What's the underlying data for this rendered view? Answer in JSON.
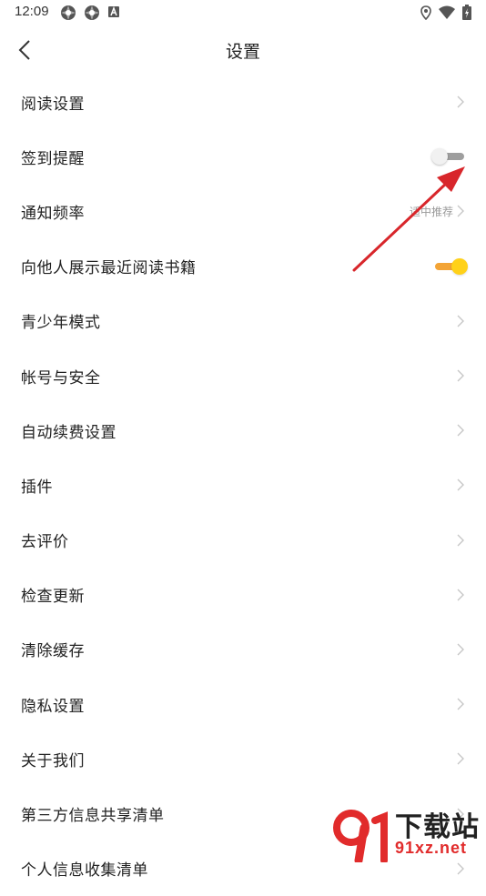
{
  "status_bar": {
    "time": "12:09"
  },
  "header": {
    "title": "设置"
  },
  "settings": [
    {
      "label": "阅读设置",
      "type": "link"
    },
    {
      "label": "签到提醒",
      "type": "toggle",
      "enabled": false
    },
    {
      "label": "通知频率",
      "type": "link",
      "value": "适中推荐"
    },
    {
      "label": "向他人展示最近阅读书籍",
      "type": "toggle",
      "enabled": true
    },
    {
      "label": "青少年模式",
      "type": "link"
    },
    {
      "label": "帐号与安全",
      "type": "link"
    },
    {
      "label": "自动续费设置",
      "type": "link"
    },
    {
      "label": "插件",
      "type": "link"
    },
    {
      "label": "去评价",
      "type": "link"
    },
    {
      "label": "检查更新",
      "type": "link"
    },
    {
      "label": "清除缓存",
      "type": "link"
    },
    {
      "label": "隐私设置",
      "type": "link"
    },
    {
      "label": "关于我们",
      "type": "link"
    },
    {
      "label": "第三方信息共享清单",
      "type": "link"
    },
    {
      "label": "个人信息收集清单",
      "type": "link"
    }
  ],
  "colors": {
    "toggle_on_track": "#f3a436",
    "toggle_on_knob": "#ffd119",
    "toggle_off_track": "#9e9e9e",
    "annotation_arrow": "#d8262b"
  },
  "watermark": {
    "text": "下载站",
    "domain": "91xz.net"
  }
}
